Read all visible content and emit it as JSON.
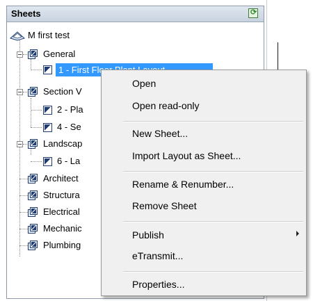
{
  "panel": {
    "title": "Sheets"
  },
  "tree": {
    "root": "M first test",
    "general": "General",
    "selected_sheet": "1 - First Floor Plant Layout",
    "section": "Section V",
    "sheet2": "2 - Pla",
    "sheet4": "4 - Se",
    "landscape": "Landscap",
    "sheet6": "6 - La",
    "architect": "Architect",
    "structural": "Structura",
    "electrical": "Electrical",
    "mechanical": "Mechanic",
    "plumbing": "Plumbing"
  },
  "menu": {
    "open": "Open",
    "open_readonly": "Open read-only",
    "new_sheet": "New Sheet...",
    "import_layout": "Import Layout as Sheet...",
    "rename": "Rename & Renumber...",
    "remove": "Remove Sheet",
    "publish": "Publish",
    "etransmit": "eTransmit...",
    "properties": "Properties..."
  },
  "colors": {
    "selection": "#3399ff",
    "header": "#c8d3e0"
  }
}
